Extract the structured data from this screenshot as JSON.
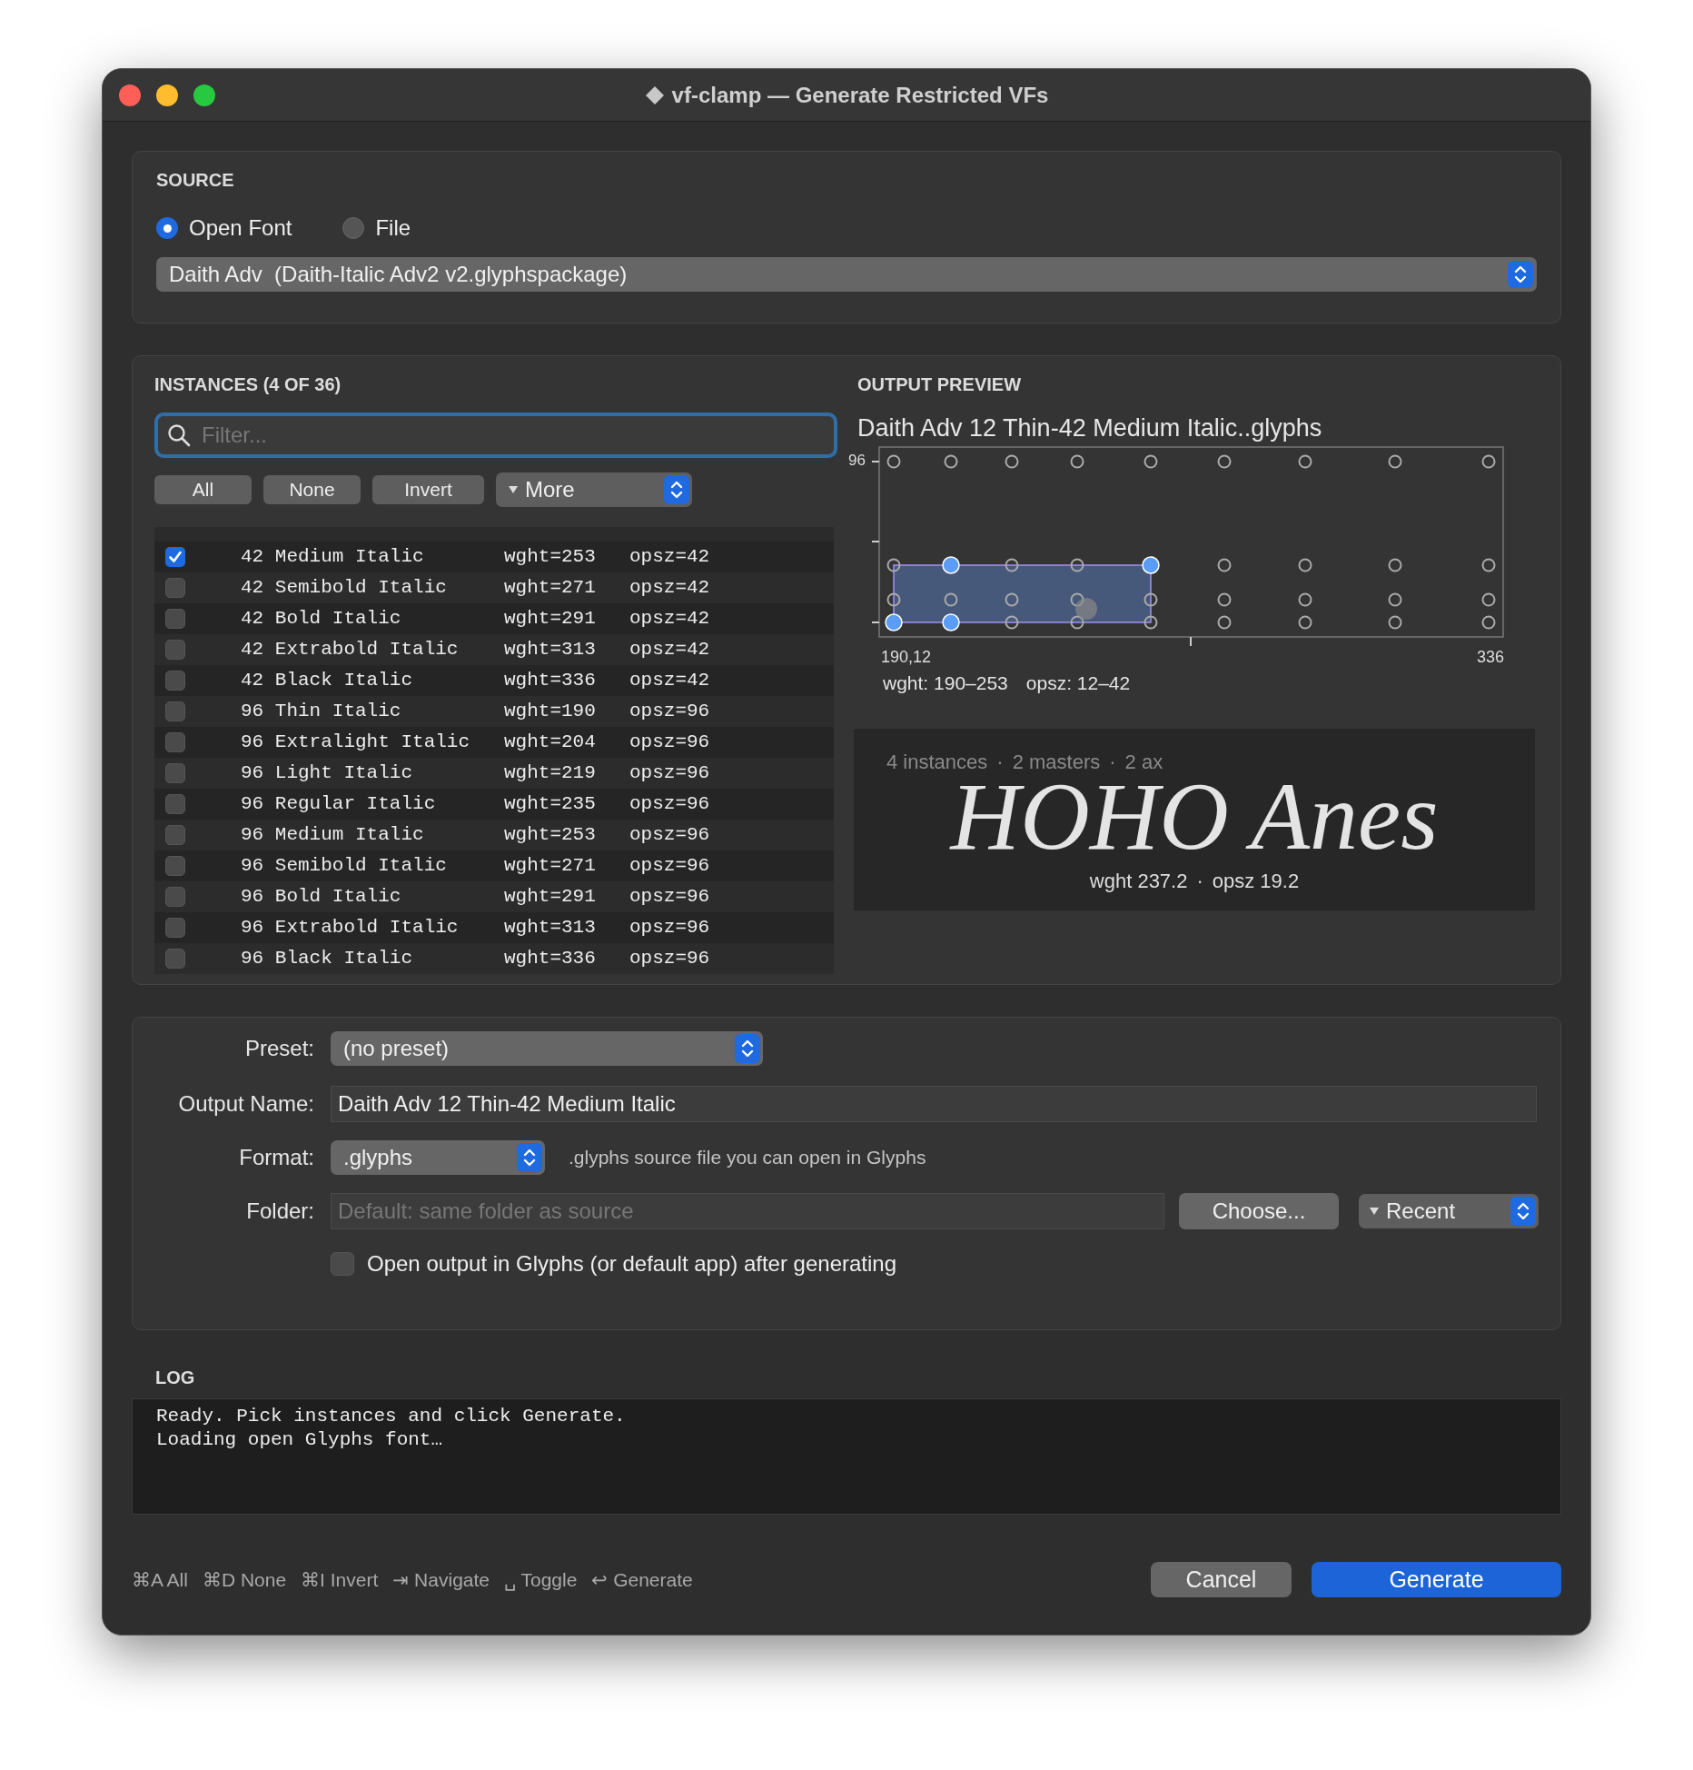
{
  "window": {
    "title": "vf-clamp — Generate Restricted VFs"
  },
  "source": {
    "heading": "SOURCE",
    "options": [
      {
        "label": "Open Font",
        "selected": true
      },
      {
        "label": "File",
        "selected": false
      }
    ],
    "font_popup": "Daith Adv  (Daith-Italic Adv2 v2.glyphspackage)"
  },
  "instances": {
    "heading": "INSTANCES (4 OF 36)",
    "filter": {
      "placeholder": "Filter..."
    },
    "buttons": [
      "All",
      "None",
      "Invert"
    ],
    "more_popup": "More",
    "rows": [
      {
        "name": "42 Medium Italic",
        "wght": "wght=253",
        "opsz": "opsz=42",
        "checked": true
      },
      {
        "name": "42 Semibold Italic",
        "wght": "wght=271",
        "opsz": "opsz=42",
        "checked": false
      },
      {
        "name": "42 Bold Italic",
        "wght": "wght=291",
        "opsz": "opsz=42",
        "checked": false
      },
      {
        "name": "42 Extrabold Italic",
        "wght": "wght=313",
        "opsz": "opsz=42",
        "checked": false
      },
      {
        "name": "42 Black Italic",
        "wght": "wght=336",
        "opsz": "opsz=42",
        "checked": false
      },
      {
        "name": "96 Thin Italic",
        "wght": "wght=190",
        "opsz": "opsz=96",
        "checked": false
      },
      {
        "name": "96 Extralight Italic",
        "wght": "wght=204",
        "opsz": "opsz=96",
        "checked": false
      },
      {
        "name": "96 Light Italic",
        "wght": "wght=219",
        "opsz": "opsz=96",
        "checked": false
      },
      {
        "name": "96 Regular Italic",
        "wght": "wght=235",
        "opsz": "opsz=96",
        "checked": false
      },
      {
        "name": "96 Medium Italic",
        "wght": "wght=253",
        "opsz": "opsz=96",
        "checked": false
      },
      {
        "name": "96 Semibold Italic",
        "wght": "wght=271",
        "opsz": "opsz=96",
        "checked": false
      },
      {
        "name": "96 Bold Italic",
        "wght": "wght=291",
        "opsz": "opsz=96",
        "checked": false
      },
      {
        "name": "96 Extrabold Italic",
        "wght": "wght=313",
        "opsz": "opsz=96",
        "checked": false
      },
      {
        "name": "96 Black Italic",
        "wght": "wght=336",
        "opsz": "opsz=96",
        "checked": false
      }
    ]
  },
  "preview": {
    "heading": "OUTPUT PREVIEW",
    "filename": "Daith Adv 12 Thin-42 Medium Italic..glyphs",
    "plot": {
      "y_label": "96",
      "x_start_label": "190,12",
      "x_end_label": "336"
    },
    "ranges": [
      "wght: 190–253",
      "opsz: 12–42"
    ],
    "sample": {
      "separator": "·",
      "stats": [
        "4 instances",
        "2 masters",
        "2 ax"
      ],
      "text": "HOHO Anes",
      "coords": [
        "wght 237.2",
        "opsz 19.2"
      ]
    }
  },
  "options": {
    "preset": {
      "label": "Preset:",
      "value": "(no preset)"
    },
    "output_name": {
      "label": "Output Name:",
      "value": "Daith Adv 12 Thin-42 Medium Italic"
    },
    "format": {
      "label": "Format:",
      "value": ".glyphs",
      "hint": ".glyphs source file you can open in Glyphs"
    },
    "folder": {
      "label": "Folder:",
      "placeholder": "Default: same folder as source",
      "choose": "Choose...",
      "recent": "Recent"
    },
    "open_after": {
      "label": "Open output in Glyphs (or default app) after generating",
      "checked": false
    }
  },
  "log": {
    "heading": "LOG",
    "lines": [
      "Ready. Pick instances and click Generate.",
      "Loading open Glyphs font…"
    ]
  },
  "footer": {
    "shortcuts": [
      "⌘A All",
      "⌘D None",
      "⌘I Invert",
      "⇥ Navigate",
      "␣ Toggle",
      "↩ Generate"
    ],
    "cancel": "Cancel",
    "generate": "Generate"
  }
}
